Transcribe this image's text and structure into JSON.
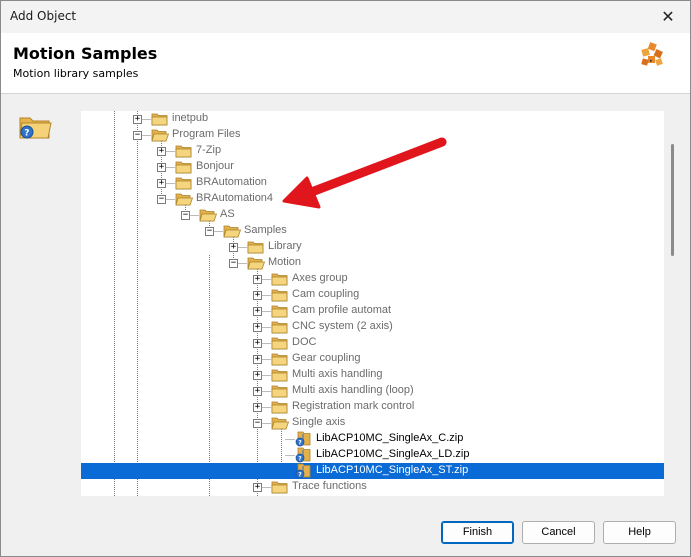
{
  "window": {
    "title": "Add Object",
    "close_symbol": "✕"
  },
  "header": {
    "title": "Motion Samples",
    "subtitle": "Motion library samples",
    "logo_icon": "motion-samples-logo-icon"
  },
  "tree": {
    "items": [
      {
        "label": "inetpub",
        "level": 0,
        "expander": "+",
        "icon": "folder-closed-icon"
      },
      {
        "label": "Program Files",
        "level": 0,
        "expander": "-",
        "icon": "folder-open-icon"
      },
      {
        "label": "7-Zip",
        "level": 1,
        "expander": "+",
        "icon": "folder-closed-icon"
      },
      {
        "label": "Bonjour",
        "level": 1,
        "expander": "+",
        "icon": "folder-closed-icon"
      },
      {
        "label": "BRAutomation",
        "level": 1,
        "expander": "+",
        "icon": "folder-closed-icon"
      },
      {
        "label": "BRAutomation4",
        "level": 1,
        "expander": "-",
        "icon": "folder-open-icon"
      },
      {
        "label": "AS",
        "level": 2,
        "expander": "-",
        "icon": "folder-open-icon"
      },
      {
        "label": "Samples",
        "level": 3,
        "expander": "-",
        "icon": "folder-open-icon"
      },
      {
        "label": "Library",
        "level": 4,
        "expander": "+",
        "icon": "folder-closed-icon"
      },
      {
        "label": "Motion",
        "level": 4,
        "expander": "-",
        "icon": "folder-open-icon"
      },
      {
        "label": "Axes group",
        "level": 5,
        "expander": "+",
        "icon": "folder-closed-icon"
      },
      {
        "label": "Cam coupling",
        "level": 5,
        "expander": "+",
        "icon": "folder-closed-icon"
      },
      {
        "label": "Cam profile automat",
        "level": 5,
        "expander": "+",
        "icon": "folder-closed-icon"
      },
      {
        "label": "CNC system (2 axis)",
        "level": 5,
        "expander": "+",
        "icon": "folder-closed-icon"
      },
      {
        "label": "DOC",
        "level": 5,
        "expander": "+",
        "icon": "folder-closed-icon"
      },
      {
        "label": "Gear coupling",
        "level": 5,
        "expander": "+",
        "icon": "folder-closed-icon"
      },
      {
        "label": "Multi axis handling",
        "level": 5,
        "expander": "+",
        "icon": "folder-closed-icon"
      },
      {
        "label": "Multi axis handling (loop)",
        "level": 5,
        "expander": "+",
        "icon": "folder-closed-icon"
      },
      {
        "label": "Registration mark control",
        "level": 5,
        "expander": "+",
        "icon": "folder-closed-icon"
      },
      {
        "label": "Single axis",
        "level": 5,
        "expander": "-",
        "icon": "folder-open-icon"
      },
      {
        "label": "LibACP10MC_SingleAx_C.zip",
        "level": 6,
        "expander": "",
        "icon": "zip-file-icon",
        "file": true
      },
      {
        "label": "LibACP10MC_SingleAx_LD.zip",
        "level": 6,
        "expander": "",
        "icon": "zip-file-icon",
        "file": true
      },
      {
        "label": "LibACP10MC_SingleAx_ST.zip",
        "level": 6,
        "expander": "",
        "icon": "zip-file-icon",
        "file": true,
        "selected": true
      },
      {
        "label": "Trace functions",
        "level": 5,
        "expander": "+",
        "icon": "folder-closed-icon"
      }
    ]
  },
  "buttons": {
    "finish": "Finish",
    "cancel": "Cancel",
    "help": "Help"
  },
  "colors": {
    "selection": "#0a6ad6",
    "arrow": "#e0161c",
    "folder": "#f2c35c"
  },
  "annotation_arrow": "red-arrow-pointing-to-BRAutomation4"
}
